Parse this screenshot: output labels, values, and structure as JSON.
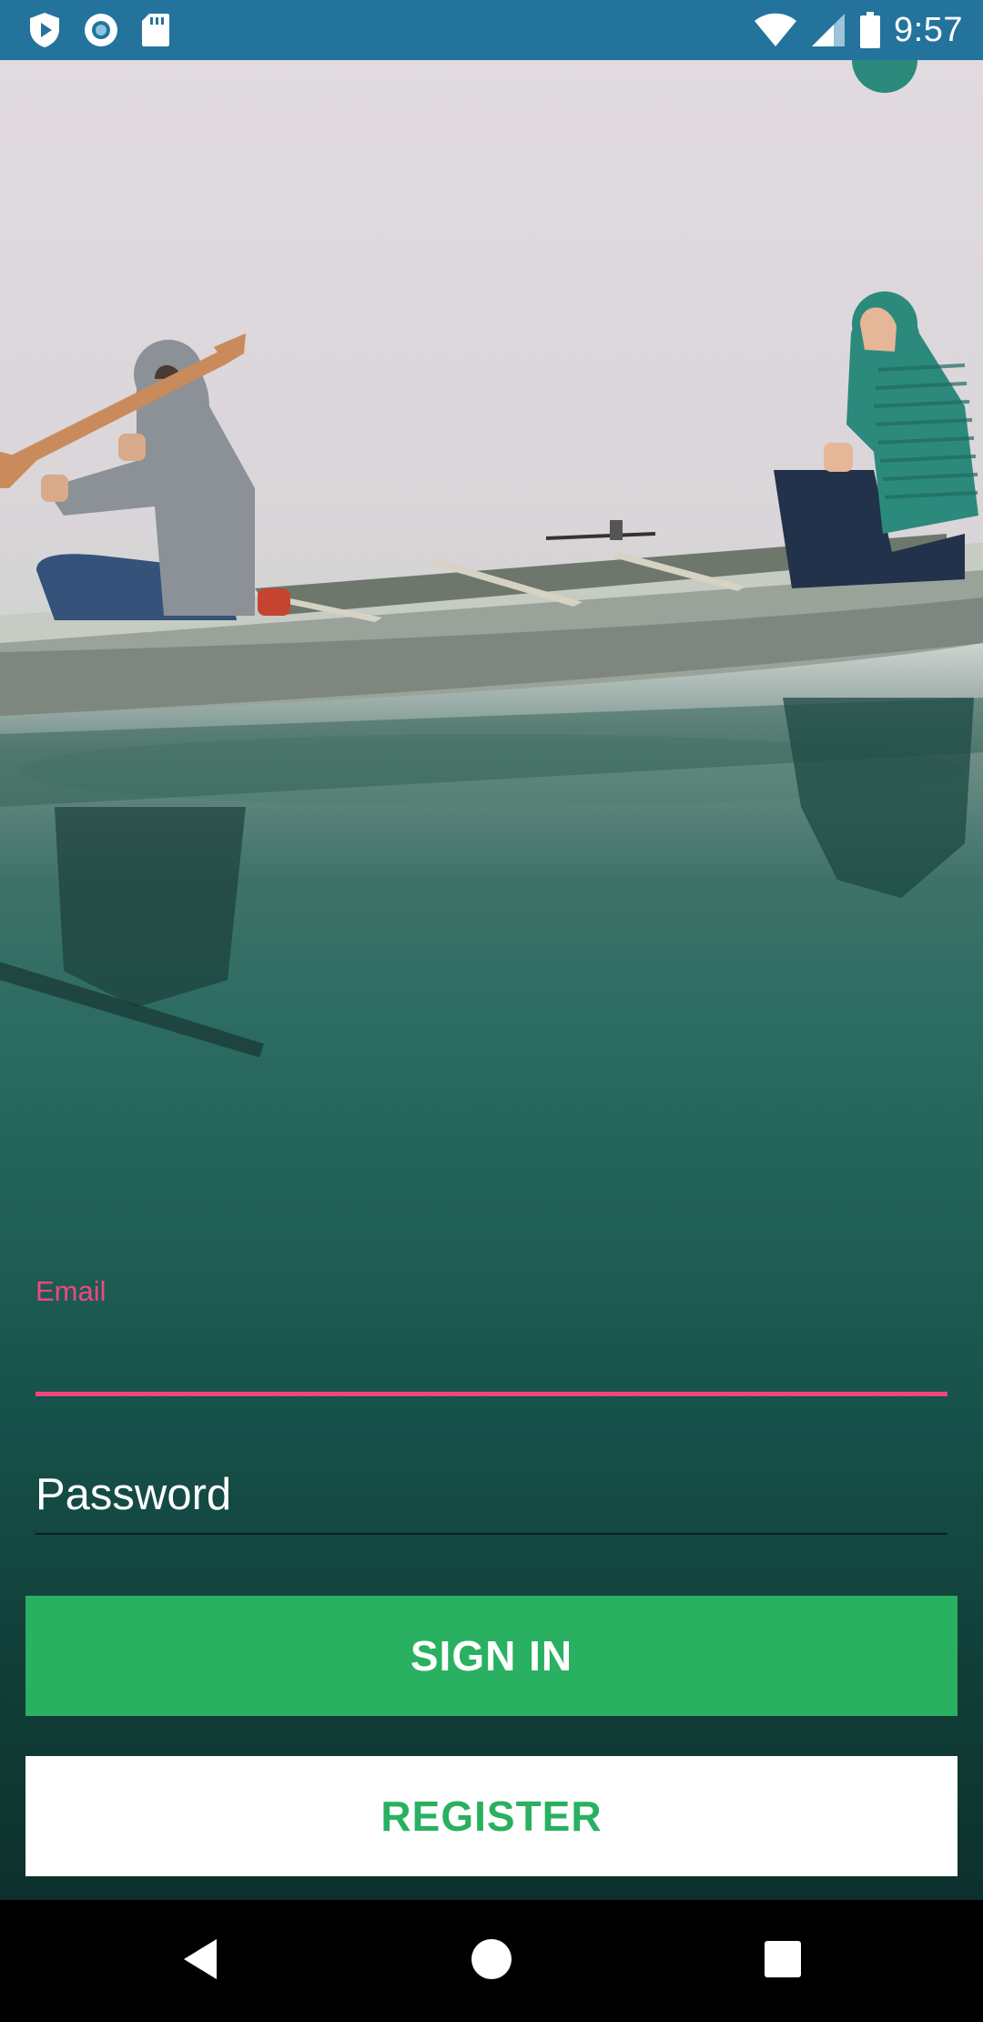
{
  "status_bar": {
    "time": "9:57",
    "left_icons": [
      "play-protect-icon",
      "sync-circle-icon",
      "sd-card-icon"
    ],
    "right_icons": [
      "wifi-icon",
      "cell-signal-icon",
      "battery-icon"
    ],
    "background_color": "#23739c"
  },
  "background": {
    "image": "two-people-in-canoe-on-misty-lake"
  },
  "form": {
    "email_label": "Email",
    "email_value": "",
    "password_placeholder": "Password",
    "password_value": "",
    "accent_color": "#f0477f"
  },
  "buttons": {
    "sign_in_label": "SIGN IN",
    "register_label": "REGISTER",
    "primary_color": "#29b060"
  },
  "nav_bar": {
    "icons": [
      "back-icon",
      "home-icon",
      "recents-icon"
    ]
  }
}
